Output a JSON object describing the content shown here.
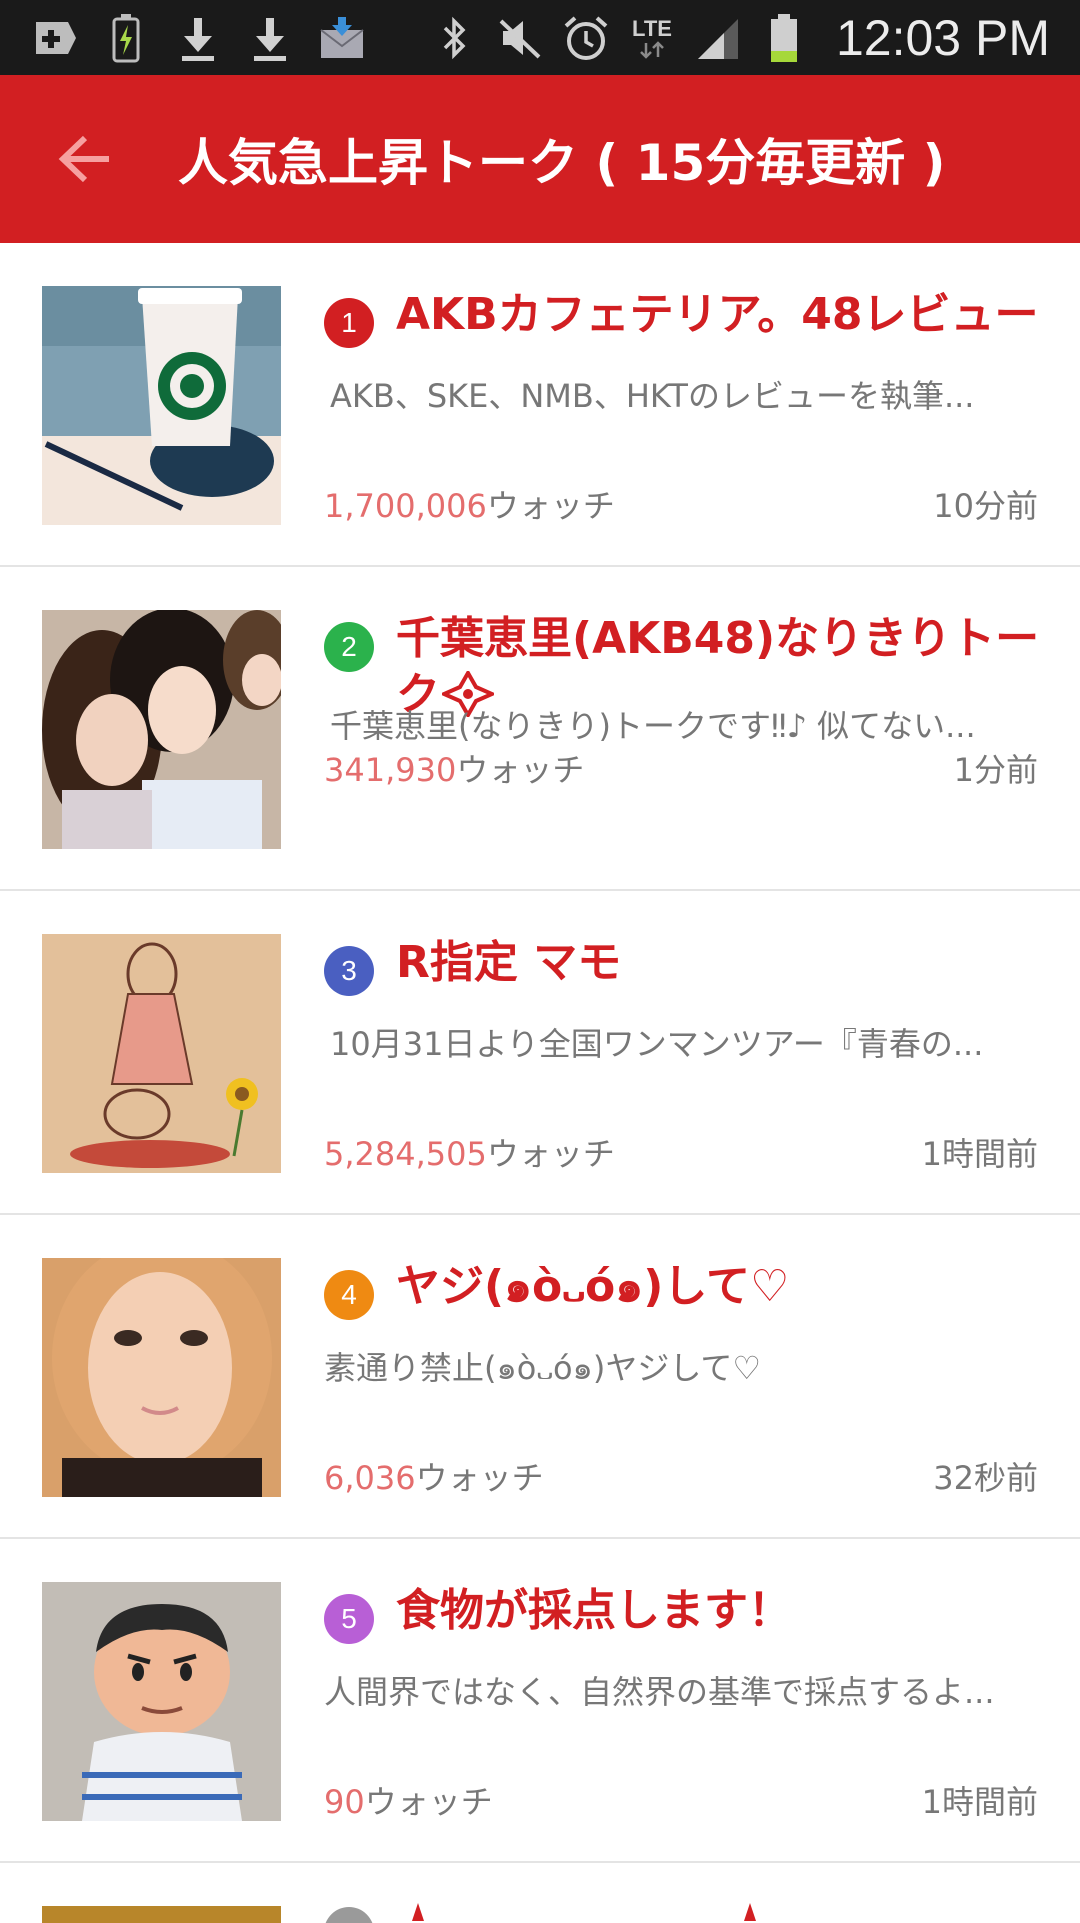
{
  "status_bar": {
    "time": "12:03 PM",
    "icons_left": [
      "add-icon",
      "battery-charging-icon",
      "download-icon",
      "download-icon",
      "mail-download-icon"
    ],
    "icons_right": [
      "bluetooth-icon",
      "mute-icon",
      "alarm-icon",
      "lte-icon",
      "signal-icon",
      "battery-icon"
    ],
    "lte_label": "LTE"
  },
  "app_bar": {
    "title": "人気急上昇トーク ( 15分毎更新 )",
    "back_icon": "arrow-left-icon",
    "color": "#d21f22"
  },
  "talks": [
    {
      "rank": "1",
      "rank_color": "#d21f22",
      "title": "AKBカフェテリア。48レビュー",
      "description": "AKB、SKE、NMB、HKTのレビューを執筆...",
      "watch_count": "1,700,006",
      "watch_suffix": "ウォッチ",
      "time": "10分前"
    },
    {
      "rank": "2",
      "rank_color": "#2bb24c",
      "title": "千葉恵里(AKB48)なりきりトーク",
      "description": "千葉恵里(なりきり)トークです‼︎♪ 似てない...",
      "watch_count": "341,930",
      "watch_suffix": "ウォッチ",
      "time": "1分前"
    },
    {
      "rank": "3",
      "rank_color": "#4a5fc1",
      "title": "R指定 マモ",
      "description": "10月31日より全国ワンマンツアー『青春の...",
      "watch_count": "5,284,505",
      "watch_suffix": "ウォッチ",
      "time": "1時間前"
    },
    {
      "rank": "4",
      "rank_color": "#ef8a12",
      "title": "ヤジ(๑ò᎑ó๑)して♡",
      "description": "素通り禁止(๑ò᎑ó๑)ヤジして♡",
      "watch_count": "6,036",
      "watch_suffix": "ウォッチ",
      "time": "32秒前"
    },
    {
      "rank": "5",
      "rank_color": "#b85fd6",
      "title": "食物が採点します！",
      "description": "人間界ではなく、自然界の基準で採点するよ...",
      "watch_count": "90",
      "watch_suffix": "ウォッチ",
      "time": "1時間前"
    }
  ]
}
